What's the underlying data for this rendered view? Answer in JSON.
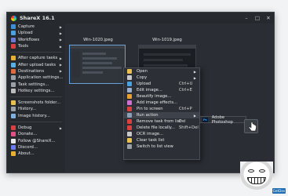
{
  "window": {
    "title": "ShareX 16.1"
  },
  "sidebar": {
    "items": [
      {
        "label": "Capture",
        "icon": "capture-icon",
        "color": "#3d8fd6",
        "submenu": true
      },
      {
        "label": "Upload",
        "icon": "upload-icon",
        "color": "#4aa3e0",
        "submenu": true
      },
      {
        "label": "Workflows",
        "icon": "workflows-icon",
        "color": "#6a7bd6",
        "submenu": true
      },
      {
        "label": "Tools",
        "icon": "tools-icon",
        "color": "#d94040",
        "submenu": true
      },
      {
        "sep": true
      },
      {
        "label": "After capture tasks",
        "icon": "after-capture-icon",
        "color": "#e8b030",
        "submenu": true
      },
      {
        "label": "After upload tasks",
        "icon": "after-upload-icon",
        "color": "#58b0e8",
        "submenu": true
      },
      {
        "label": "Destinations",
        "icon": "destinations-icon",
        "color": "#e06a40",
        "submenu": true
      },
      {
        "label": "Application settings...",
        "icon": "app-settings-icon",
        "color": "#9aa0a8",
        "submenu": false
      },
      {
        "label": "Task settings...",
        "icon": "task-settings-icon",
        "color": "#9aa0a8",
        "submenu": false
      },
      {
        "label": "Hotkey settings...",
        "icon": "hotkey-settings-icon",
        "color": "#bcbcbc",
        "submenu": false
      },
      {
        "sep": true
      },
      {
        "label": "Screenshots folder...",
        "icon": "folder-icon",
        "color": "#e8c050",
        "submenu": false
      },
      {
        "label": "History...",
        "icon": "history-icon",
        "color": "#9aa0a8",
        "submenu": false
      },
      {
        "label": "Image history...",
        "icon": "image-history-icon",
        "color": "#7fb0e0",
        "submenu": false
      },
      {
        "sep": true
      },
      {
        "label": "Debug",
        "icon": "debug-icon",
        "color": "#d94040",
        "submenu": true
      },
      {
        "label": "Donate...",
        "icon": "donate-icon",
        "color": "#e05080",
        "submenu": false
      },
      {
        "label": "Follow @ShareX...",
        "icon": "x-icon",
        "color": "#e8e8e8",
        "submenu": false
      },
      {
        "label": "Discord...",
        "icon": "discord-icon",
        "color": "#6a7bf0",
        "submenu": false
      },
      {
        "label": "About...",
        "icon": "about-icon",
        "color": "#e8b030",
        "submenu": false
      }
    ]
  },
  "thumbnails": [
    {
      "title": "Win-1020.jpeg"
    },
    {
      "title": "Win-1019.jpeg"
    }
  ],
  "context_menu": {
    "items": [
      {
        "label": "Open",
        "shortcut": "",
        "submenu": true,
        "icon": "open-icon",
        "color": "#e8c050"
      },
      {
        "label": "Copy",
        "shortcut": "",
        "submenu": true,
        "icon": "copy-icon",
        "color": "#c8c8c8"
      },
      {
        "label": "Upload",
        "shortcut": "Ctrl+U",
        "submenu": false,
        "icon": "upload-icon",
        "color": "#4aa3e0"
      },
      {
        "label": "Edit image...",
        "shortcut": "Ctrl+E",
        "submenu": false,
        "icon": "edit-image-icon",
        "color": "#9ab0d0"
      },
      {
        "label": "Beautify image...",
        "shortcut": "",
        "submenu": false,
        "icon": "beautify-icon",
        "color": "#e8a030"
      },
      {
        "label": "Add image effects...",
        "shortcut": "",
        "submenu": false,
        "icon": "image-effects-icon",
        "color": "#d070d0"
      },
      {
        "label": "Pin to screen",
        "shortcut": "Ctrl+P",
        "submenu": false,
        "icon": "pin-icon",
        "color": "#d94040"
      },
      {
        "label": "Run action",
        "shortcut": "",
        "submenu": true,
        "icon": "run-action-icon",
        "color": "#8aa0b8",
        "highlight": true
      },
      {
        "label": "Remove task from list",
        "shortcut": "Del",
        "submenu": false,
        "icon": "remove-icon",
        "color": "#d94040"
      },
      {
        "label": "Delete file locally...",
        "shortcut": "Shift+Del",
        "submenu": false,
        "icon": "delete-icon",
        "color": "#d94040"
      },
      {
        "label": "OCR image...",
        "shortcut": "",
        "submenu": false,
        "icon": "ocr-icon",
        "color": "#c8c8c8"
      },
      {
        "label": "Clear task list",
        "shortcut": "",
        "submenu": false,
        "icon": "clear-icon",
        "color": "#e8c050"
      },
      {
        "label": "Switch to list view",
        "shortcut": "",
        "submenu": false,
        "icon": "list-view-icon",
        "color": "#9aa0a8"
      }
    ]
  },
  "submenu": {
    "label": "Adobe Photoshop",
    "icon_text": "Ps"
  },
  "corner_tag": {
    "label": "GetDev"
  }
}
